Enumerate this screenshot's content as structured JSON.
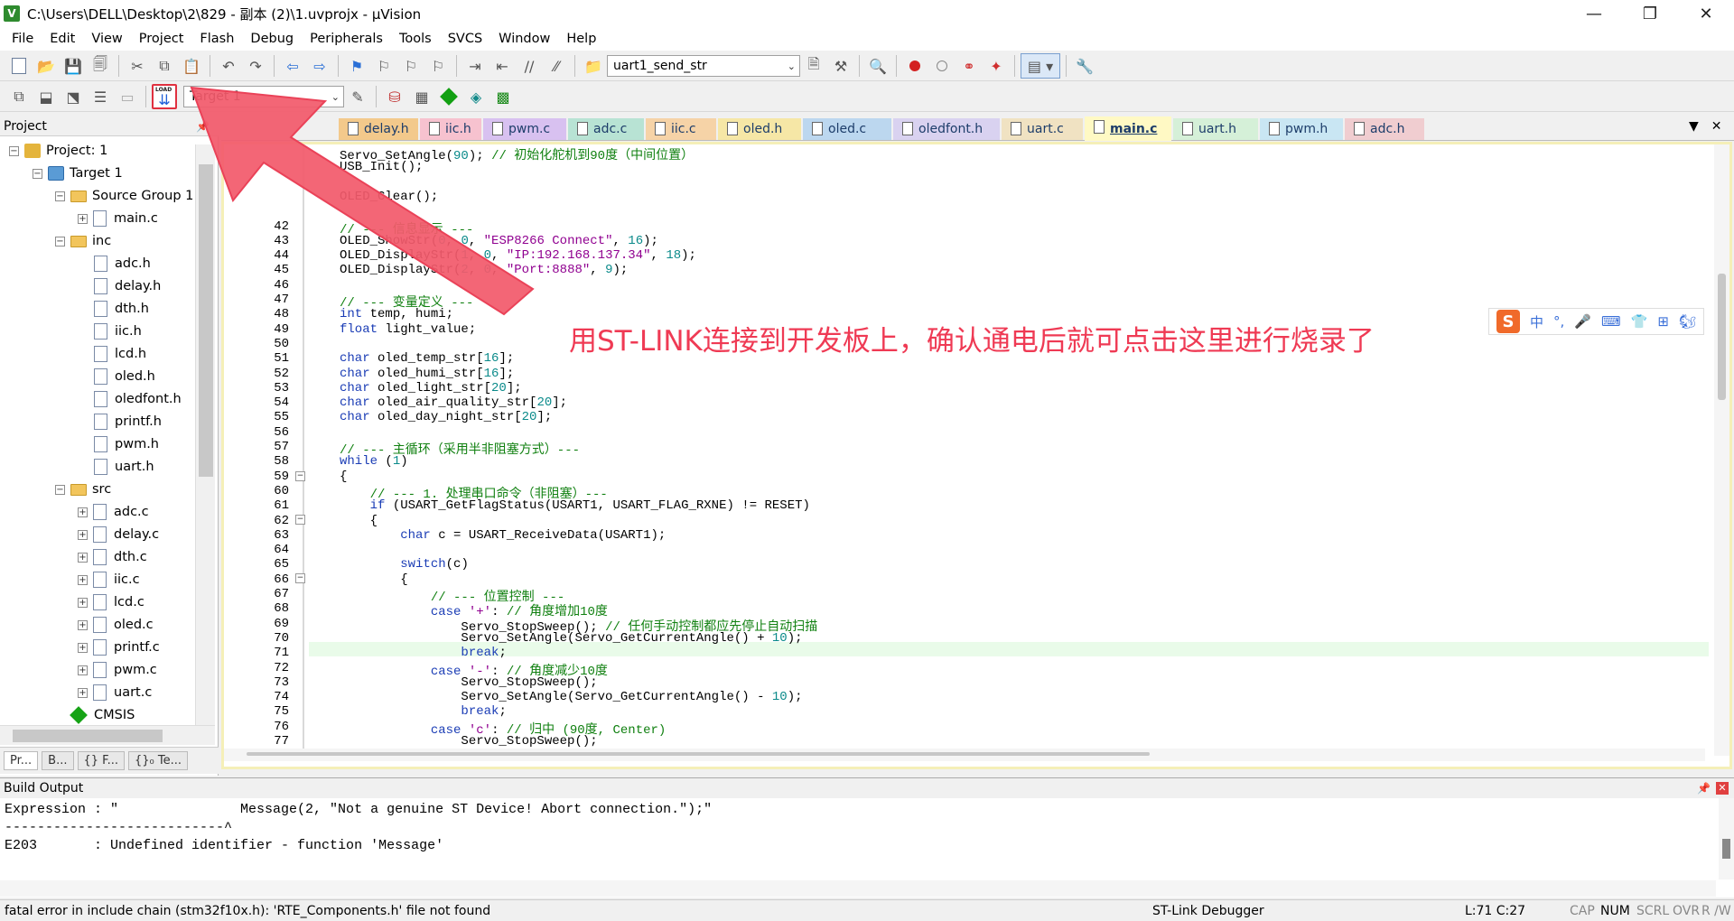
{
  "window": {
    "title": "C:\\Users\\DELL\\Desktop\\2\\829 - 副本 (2)\\1.uvprojx - µVision",
    "app_icon": "V",
    "controls": [
      "—",
      "❐",
      "✕"
    ]
  },
  "menu": [
    "File",
    "Edit",
    "View",
    "Project",
    "Flash",
    "Debug",
    "Peripherals",
    "Tools",
    "SVCS",
    "Window",
    "Help"
  ],
  "toolbar": {
    "function_combo": "uart1_send_str",
    "target_combo": "Target 1",
    "load_label": "LOAD"
  },
  "project_panel": {
    "header": "Project",
    "pin": "⊓",
    "tree": {
      "project": "Project: 1",
      "target": "Target 1",
      "source_group": "Source Group 1",
      "source_files": [
        "main.c"
      ],
      "inc_folder": "inc",
      "inc_files": [
        "adc.h",
        "delay.h",
        "dth.h",
        "iic.h",
        "lcd.h",
        "oled.h",
        "oledfont.h",
        "printf.h",
        "pwm.h",
        "uart.h"
      ],
      "src_folder": "src",
      "src_files": [
        "adc.c",
        "delay.c",
        "dth.c",
        "iic.c",
        "lcd.c",
        "oled.c",
        "printf.c",
        "pwm.c",
        "uart.c"
      ],
      "cmsis": "CMSIS"
    },
    "bottom_tabs": [
      "Pr...",
      "B...",
      "{} F...",
      "{}₀ Te..."
    ]
  },
  "editor_tabs": [
    {
      "label": "delay.h",
      "color": "#f3c98b"
    },
    {
      "label": "iic.h",
      "color": "#f7c2cf"
    },
    {
      "label": "pwm.c",
      "color": "#d8c1f0"
    },
    {
      "label": "adc.c",
      "color": "#b8e3d4"
    },
    {
      "label": "iic.c",
      "color": "#f6d3a7"
    },
    {
      "label": "oled.h",
      "color": "#f6e7a6"
    },
    {
      "label": "oled.c",
      "color": "#bcd7ef"
    },
    {
      "label": "oledfont.h",
      "color": "#d9d2f0"
    },
    {
      "label": "uart.c",
      "color": "#f0e2c2"
    },
    {
      "label": "main.c",
      "color": "#fbf3b0"
    },
    {
      "label": "uart.h",
      "color": "#d5f0d8"
    },
    {
      "label": "pwm.h",
      "color": "#c9e6f3"
    },
    {
      "label": "adc.h",
      "color": "#f0cdd0"
    }
  ],
  "active_tab": "main.c",
  "code_lines": [
    {
      "n": "",
      "t": "Servo_SetAngle(90); // 初始化舵机到90度（中间位置）"
    },
    {
      "n": "",
      "t": "USB_Init();"
    },
    {
      "n": "",
      "t": ""
    },
    {
      "n": "",
      "t": "OLED_Clear();"
    },
    {
      "n": "",
      "t": ""
    },
    {
      "n": "42",
      "t": "// --- 信息显示 ---"
    },
    {
      "n": "43",
      "t": "OLED_ShowStr(0, 0, \"ESP8266 Connect\", 16);"
    },
    {
      "n": "44",
      "t": "OLED_DisplayStr(1, 0, \"IP:192.168.137.34\", 18);"
    },
    {
      "n": "45",
      "t": "OLED_DisplayStr(2, 0, \"Port:8888\", 9);"
    },
    {
      "n": "46",
      "t": ""
    },
    {
      "n": "47",
      "t": "// --- 变量定义 ---"
    },
    {
      "n": "48",
      "t": "int temp, humi;"
    },
    {
      "n": "49",
      "t": "float light_value;"
    },
    {
      "n": "50",
      "t": ""
    },
    {
      "n": "51",
      "t": "char oled_temp_str[16];"
    },
    {
      "n": "52",
      "t": "char oled_humi_str[16];"
    },
    {
      "n": "53",
      "t": "char oled_light_str[20];"
    },
    {
      "n": "54",
      "t": "char oled_air_quality_str[20];"
    },
    {
      "n": "55",
      "t": "char oled_day_night_str[20];"
    },
    {
      "n": "56",
      "t": ""
    },
    {
      "n": "57",
      "t": "// --- 主循环（采用半非阻塞方式）---"
    },
    {
      "n": "58",
      "t": "while (1)"
    },
    {
      "n": "59",
      "t": "{"
    },
    {
      "n": "60",
      "t": "    // --- 1. 处理串口命令（非阻塞）---"
    },
    {
      "n": "61",
      "t": "    if (USART_GetFlagStatus(USART1, USART_FLAG_RXNE) != RESET)"
    },
    {
      "n": "62",
      "t": "    {"
    },
    {
      "n": "63",
      "t": "        char c = USART_ReceiveData(USART1);"
    },
    {
      "n": "64",
      "t": ""
    },
    {
      "n": "65",
      "t": "        switch(c)"
    },
    {
      "n": "66",
      "t": "        {"
    },
    {
      "n": "67",
      "t": "            // --- 位置控制 ---"
    },
    {
      "n": "68",
      "t": "            case '+': // 角度增加10度"
    },
    {
      "n": "69",
      "t": "                Servo_StopSweep(); // 任何手动控制都应先停止自动扫描"
    },
    {
      "n": "70",
      "t": "                Servo_SetAngle(Servo_GetCurrentAngle() + 10);"
    },
    {
      "n": "71",
      "t": "                break;"
    },
    {
      "n": "72",
      "t": "            case '-': // 角度减少10度"
    },
    {
      "n": "73",
      "t": "                Servo_StopSweep();"
    },
    {
      "n": "74",
      "t": "                Servo_SetAngle(Servo_GetCurrentAngle() - 10);"
    },
    {
      "n": "75",
      "t": "                break;"
    },
    {
      "n": "76",
      "t": "            case 'c': // 归中 (90度, Center)"
    },
    {
      "n": "77",
      "t": "                Servo_StopSweep();"
    }
  ],
  "build_output": {
    "header": "Build Output",
    "lines": [
      "Expression : \"               Message(2, \"Not a genuine ST Device! Abort connection.\");\"",
      "---------------------------^",
      "E203       : Undefined identifier - function 'Message'"
    ]
  },
  "status_bar": {
    "message": "fatal error in include chain (stm32f10x.h): 'RTE_Components.h' file not found",
    "debugger": "ST-Link Debugger",
    "position": "L:71 C:27",
    "flags": [
      "CAP",
      "NUM",
      "SCRL",
      "OVR",
      "R /W"
    ]
  },
  "annotation": {
    "text": "用ST-LINK连接到开发板上，确认通电后就可点击这里进行烧录了",
    "color": "#ef3a54"
  },
  "ime_bar": {
    "logo": "S",
    "items": [
      "中",
      "°,",
      "🎤",
      "⌨",
      "👕",
      "⊞",
      "🐿"
    ]
  }
}
